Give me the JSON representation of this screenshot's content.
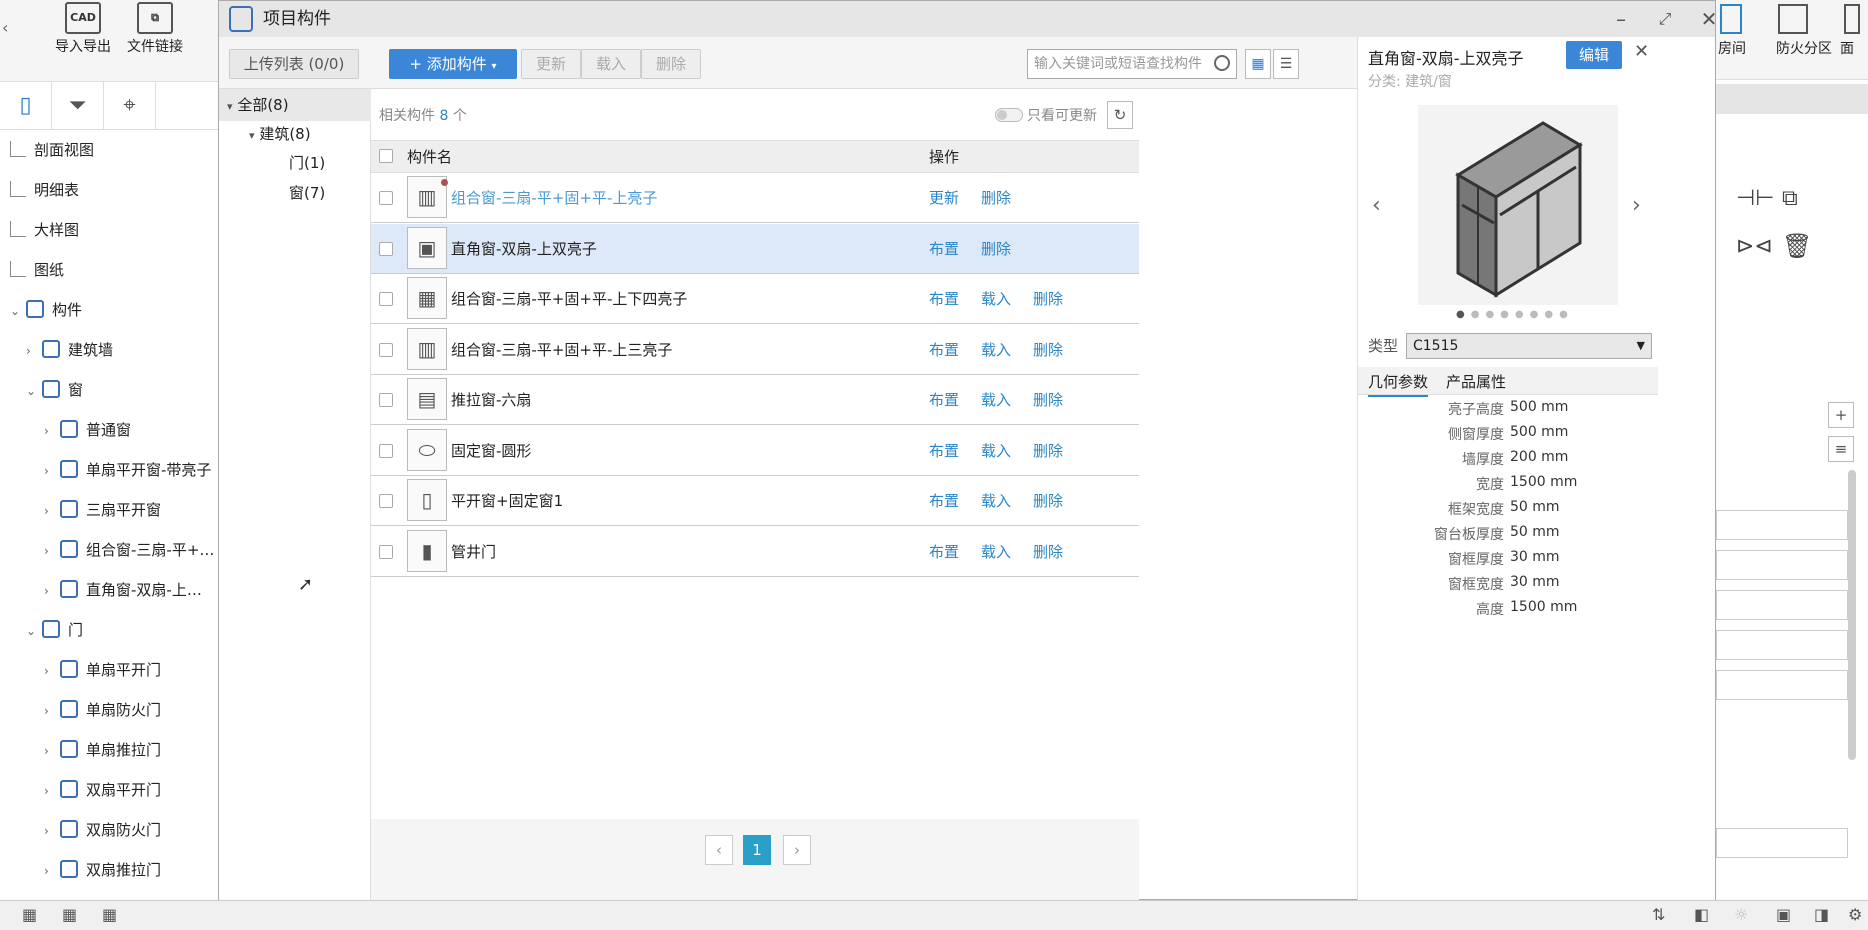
{
  "app_toolbar": {
    "import_export": "导入导出",
    "import_icon": "CAD",
    "file_link": "文件链接"
  },
  "tree": {
    "items": [
      {
        "label": "剖面视图",
        "indent": 0,
        "type": "page"
      },
      {
        "label": "明细表",
        "indent": 0,
        "type": "page"
      },
      {
        "label": "大样图",
        "indent": 0,
        "type": "page"
      },
      {
        "label": "图纸",
        "indent": 0,
        "type": "page"
      },
      {
        "label": "构件",
        "indent": 0,
        "type": "folder",
        "arrow": "open"
      },
      {
        "label": "建筑墙",
        "indent": 1,
        "type": "folder",
        "arrow": "closed"
      },
      {
        "label": "窗",
        "indent": 1,
        "type": "folder",
        "arrow": "open"
      },
      {
        "label": "普通窗",
        "indent": 2,
        "type": "folder",
        "arrow": "closed"
      },
      {
        "label": "单扇平开窗-带亮子",
        "indent": 2,
        "type": "folder",
        "arrow": "closed"
      },
      {
        "label": "三扇平开窗",
        "indent": 2,
        "type": "folder",
        "arrow": "closed"
      },
      {
        "label": "组合窗-三扇-平+…",
        "indent": 2,
        "type": "folder",
        "arrow": "closed"
      },
      {
        "label": "直角窗-双扇-上…",
        "indent": 2,
        "type": "folder",
        "arrow": "closed"
      },
      {
        "label": "门",
        "indent": 1,
        "type": "folder",
        "arrow": "open"
      },
      {
        "label": "单扇平开门",
        "indent": 2,
        "type": "folder",
        "arrow": "closed"
      },
      {
        "label": "单扇防火门",
        "indent": 2,
        "type": "folder",
        "arrow": "closed"
      },
      {
        "label": "单扇推拉门",
        "indent": 2,
        "type": "folder",
        "arrow": "closed"
      },
      {
        "label": "双扇平开门",
        "indent": 2,
        "type": "folder",
        "arrow": "closed"
      },
      {
        "label": "双扇防火门",
        "indent": 2,
        "type": "folder",
        "arrow": "closed"
      },
      {
        "label": "双扇推拉门",
        "indent": 2,
        "type": "folder",
        "arrow": "closed"
      }
    ]
  },
  "right_bg": {
    "room": "房间",
    "fire_zone": "防火分区",
    "face": "面"
  },
  "dialog": {
    "title": "项目构件",
    "toolbar": {
      "upload_list": "上传列表 (0/0)",
      "add": "+ 添加构件",
      "update": "更新",
      "load": "载入",
      "delete": "删除",
      "search_placeholder": "输入关键词或短语查找构件"
    },
    "categories": [
      {
        "label": "全部(8)"
      },
      {
        "label": "建筑(8)"
      },
      {
        "label": "门(1)"
      },
      {
        "label": "窗(7)"
      }
    ],
    "list": {
      "related_prefix": "相关构件",
      "related_count": "8",
      "related_suffix": "个",
      "only_updatable": "只看可更新",
      "col_name": "构件名",
      "col_ops": "操作",
      "rows": [
        {
          "name": "组合窗-三扇-平+固+平-上亮子",
          "op1": "更新",
          "op2": "删除",
          "op3": "",
          "highlight": true
        },
        {
          "name": "直角窗-双扇-上双亮子",
          "op1": "布置",
          "op2": "删除",
          "op3": "",
          "selected": true
        },
        {
          "name": "组合窗-三扇-平+固+平-上下四亮子",
          "op1": "布置",
          "op2": "载入",
          "op3": "删除"
        },
        {
          "name": "组合窗-三扇-平+固+平-上三亮子",
          "op1": "布置",
          "op2": "载入",
          "op3": "删除"
        },
        {
          "name": "推拉窗-六扇",
          "op1": "布置",
          "op2": "载入",
          "op3": "删除"
        },
        {
          "name": "固定窗-圆形",
          "op1": "布置",
          "op2": "载入",
          "op3": "删除"
        },
        {
          "name": "平开窗+固定窗1",
          "op1": "布置",
          "op2": "载入",
          "op3": "删除"
        },
        {
          "name": "管井门",
          "op1": "布置",
          "op2": "载入",
          "op3": "删除"
        }
      ],
      "page": "1"
    },
    "detail": {
      "title": "直角窗-双扇-上双亮子",
      "edit": "编辑",
      "category": "分类: 建筑/窗",
      "type_label": "类型",
      "type_value": "C1515",
      "tab_geometry": "几何参数",
      "tab_product": "产品属性",
      "params": [
        {
          "label": "亮子高度",
          "value": "500 mm"
        },
        {
          "label": "侧窗厚度",
          "value": "500 mm"
        },
        {
          "label": "墙厚度",
          "value": "200 mm"
        },
        {
          "label": "宽度",
          "value": "1500 mm"
        },
        {
          "label": "框架宽度",
          "value": "50 mm"
        },
        {
          "label": "窗台板厚度",
          "value": "50 mm"
        },
        {
          "label": "窗框厚度",
          "value": "30 mm"
        },
        {
          "label": "窗框宽度",
          "value": "30 mm"
        },
        {
          "label": "高度",
          "value": "1500 mm"
        }
      ]
    }
  }
}
